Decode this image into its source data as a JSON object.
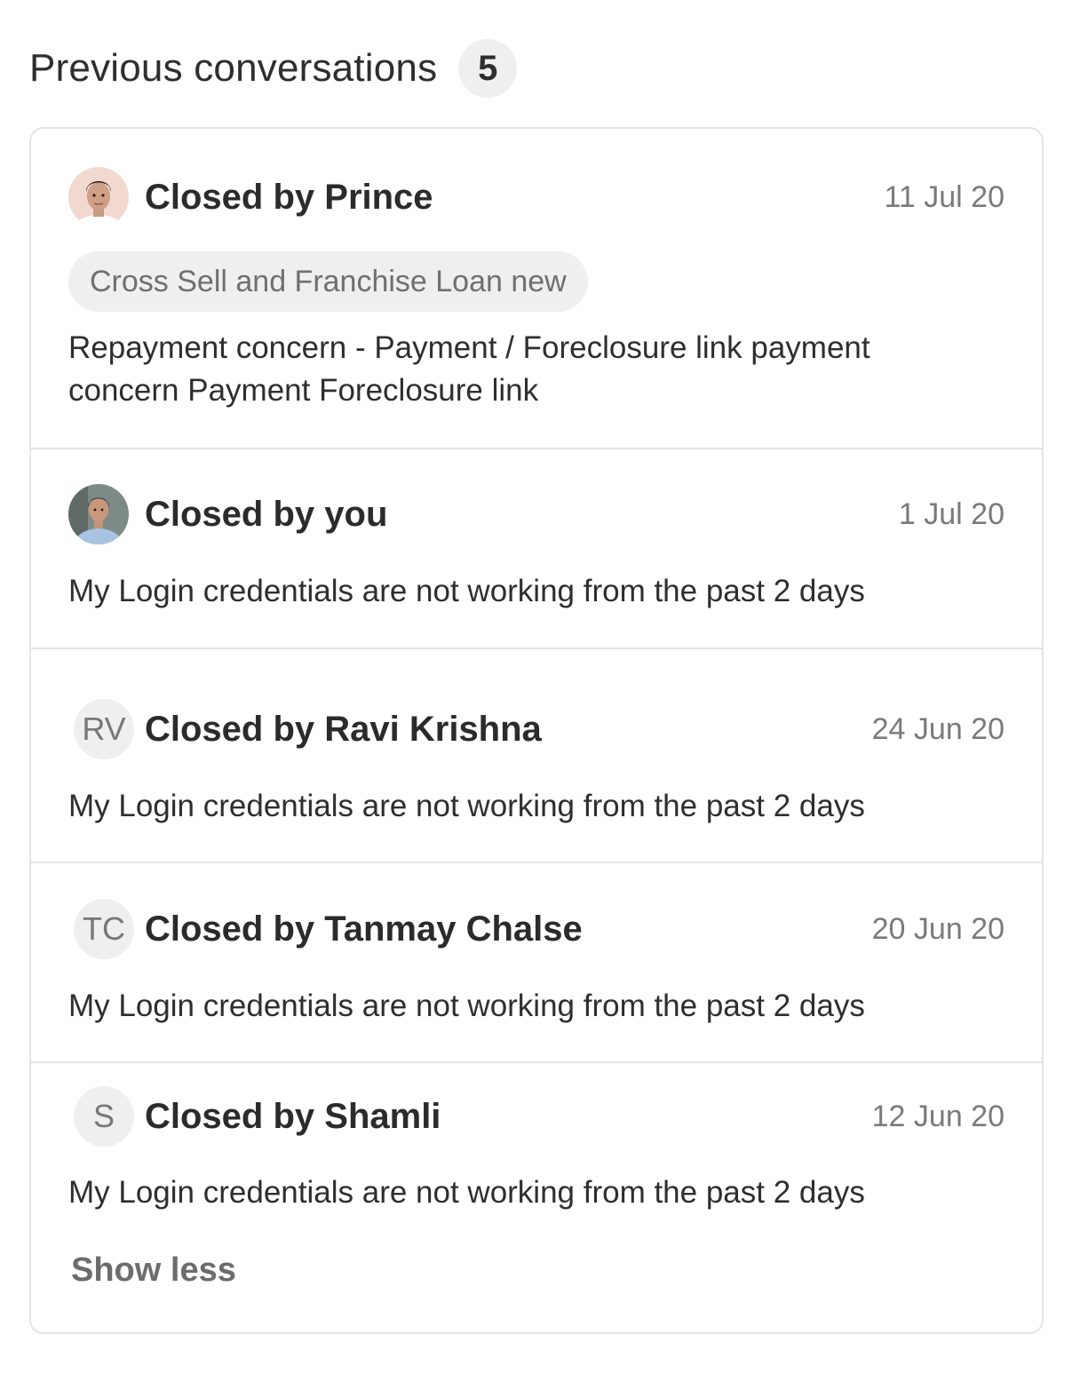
{
  "header": {
    "title": "Previous conversations",
    "count": "5"
  },
  "conversations": [
    {
      "closed_by": "Closed by Prince",
      "date": "11 Jul 20",
      "avatar": {
        "type": "photo",
        "icon": "avatar-photo-prince"
      },
      "tag": "Cross Sell and Franchise Loan new",
      "description": "Repayment concern - Payment / Foreclosure link payment concern Payment Foreclosure link"
    },
    {
      "closed_by": "Closed by you",
      "date": "1 Jul 20",
      "avatar": {
        "type": "photo",
        "icon": "avatar-photo-you"
      },
      "description": "My Login credentials are not working from the past 2 days"
    },
    {
      "closed_by": "Closed by Ravi Krishna",
      "date": "24 Jun 20",
      "avatar": {
        "type": "initials",
        "initials": "RV"
      },
      "description": "My Login credentials are not working from the past 2 days"
    },
    {
      "closed_by": "Closed by Tanmay Chalse",
      "date": "20 Jun 20",
      "avatar": {
        "type": "initials",
        "initials": "TC"
      },
      "description": "My Login credentials are not working from the past 2 days"
    },
    {
      "closed_by": "Closed by Shamli",
      "date": "12 Jun 20",
      "avatar": {
        "type": "initials",
        "initials": "S"
      },
      "description": "My Login credentials are not working from the past 2 days"
    }
  ],
  "footer": {
    "show_less_label": "Show less"
  },
  "colors": {
    "border": "#e4e4e4",
    "badge_bg": "#efefef",
    "text_primary": "#2b2b2b",
    "text_muted": "#7a7a7a"
  }
}
